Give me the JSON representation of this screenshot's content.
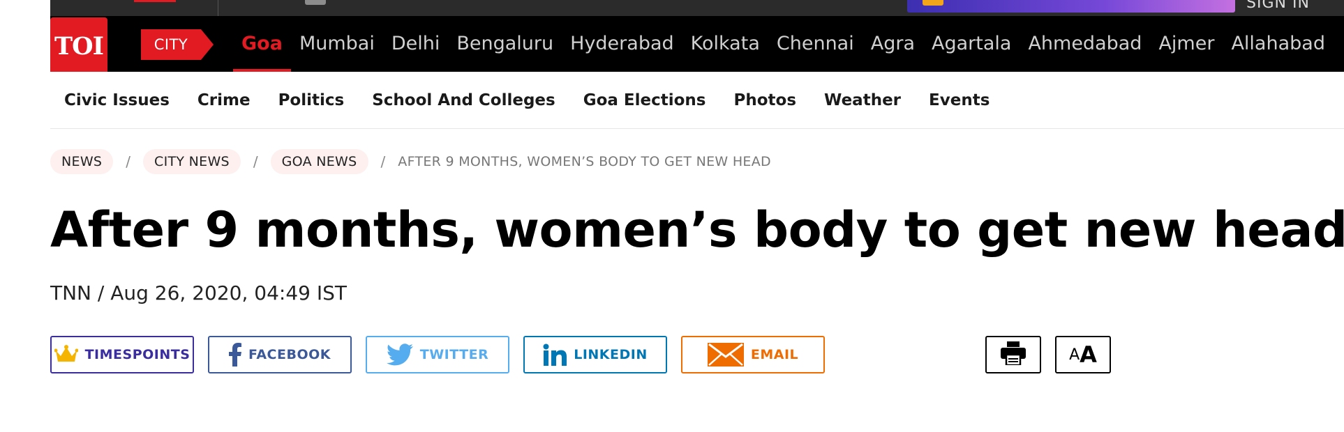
{
  "top_strip": {
    "signin_label": "SIGN IN"
  },
  "logo": {
    "text": "TOI"
  },
  "city_nav": {
    "tag": "CITY",
    "cities": [
      "Goa",
      "Mumbai",
      "Delhi",
      "Bengaluru",
      "Hyderabad",
      "Kolkata",
      "Chennai",
      "Agra",
      "Agartala",
      "Ahmedabad",
      "Ajmer",
      "Allahabad"
    ],
    "active": "Goa"
  },
  "sub_nav": [
    "Civic Issues",
    "Crime",
    "Politics",
    "School And Colleges",
    "Goa Elections",
    "Photos",
    "Weather",
    "Events"
  ],
  "breadcrumb": {
    "items": [
      "NEWS",
      "CITY NEWS",
      "GOA NEWS"
    ],
    "separator": "/",
    "current": "AFTER 9 MONTHS, WOMEN’S BODY TO GET NEW HEAD"
  },
  "article": {
    "headline": "After 9 months, women’s body to get new head",
    "byline": "TNN / Aug 26, 2020, 04:49 IST"
  },
  "share": {
    "timespoints": "TIMESPOINTS",
    "facebook": "FACEBOOK",
    "twitter": "TWITTER",
    "linkedin": "LINKEDIN",
    "email": "EMAIL"
  },
  "tools": {
    "font_small": "A",
    "font_large": "A"
  },
  "colors": {
    "brand_red": "#e21b22",
    "nav_bg": "#000000",
    "timespoints": "#3a2da0",
    "facebook": "#3b5998",
    "twitter": "#55acee",
    "linkedin": "#0077b5",
    "email": "#ef6c00"
  }
}
